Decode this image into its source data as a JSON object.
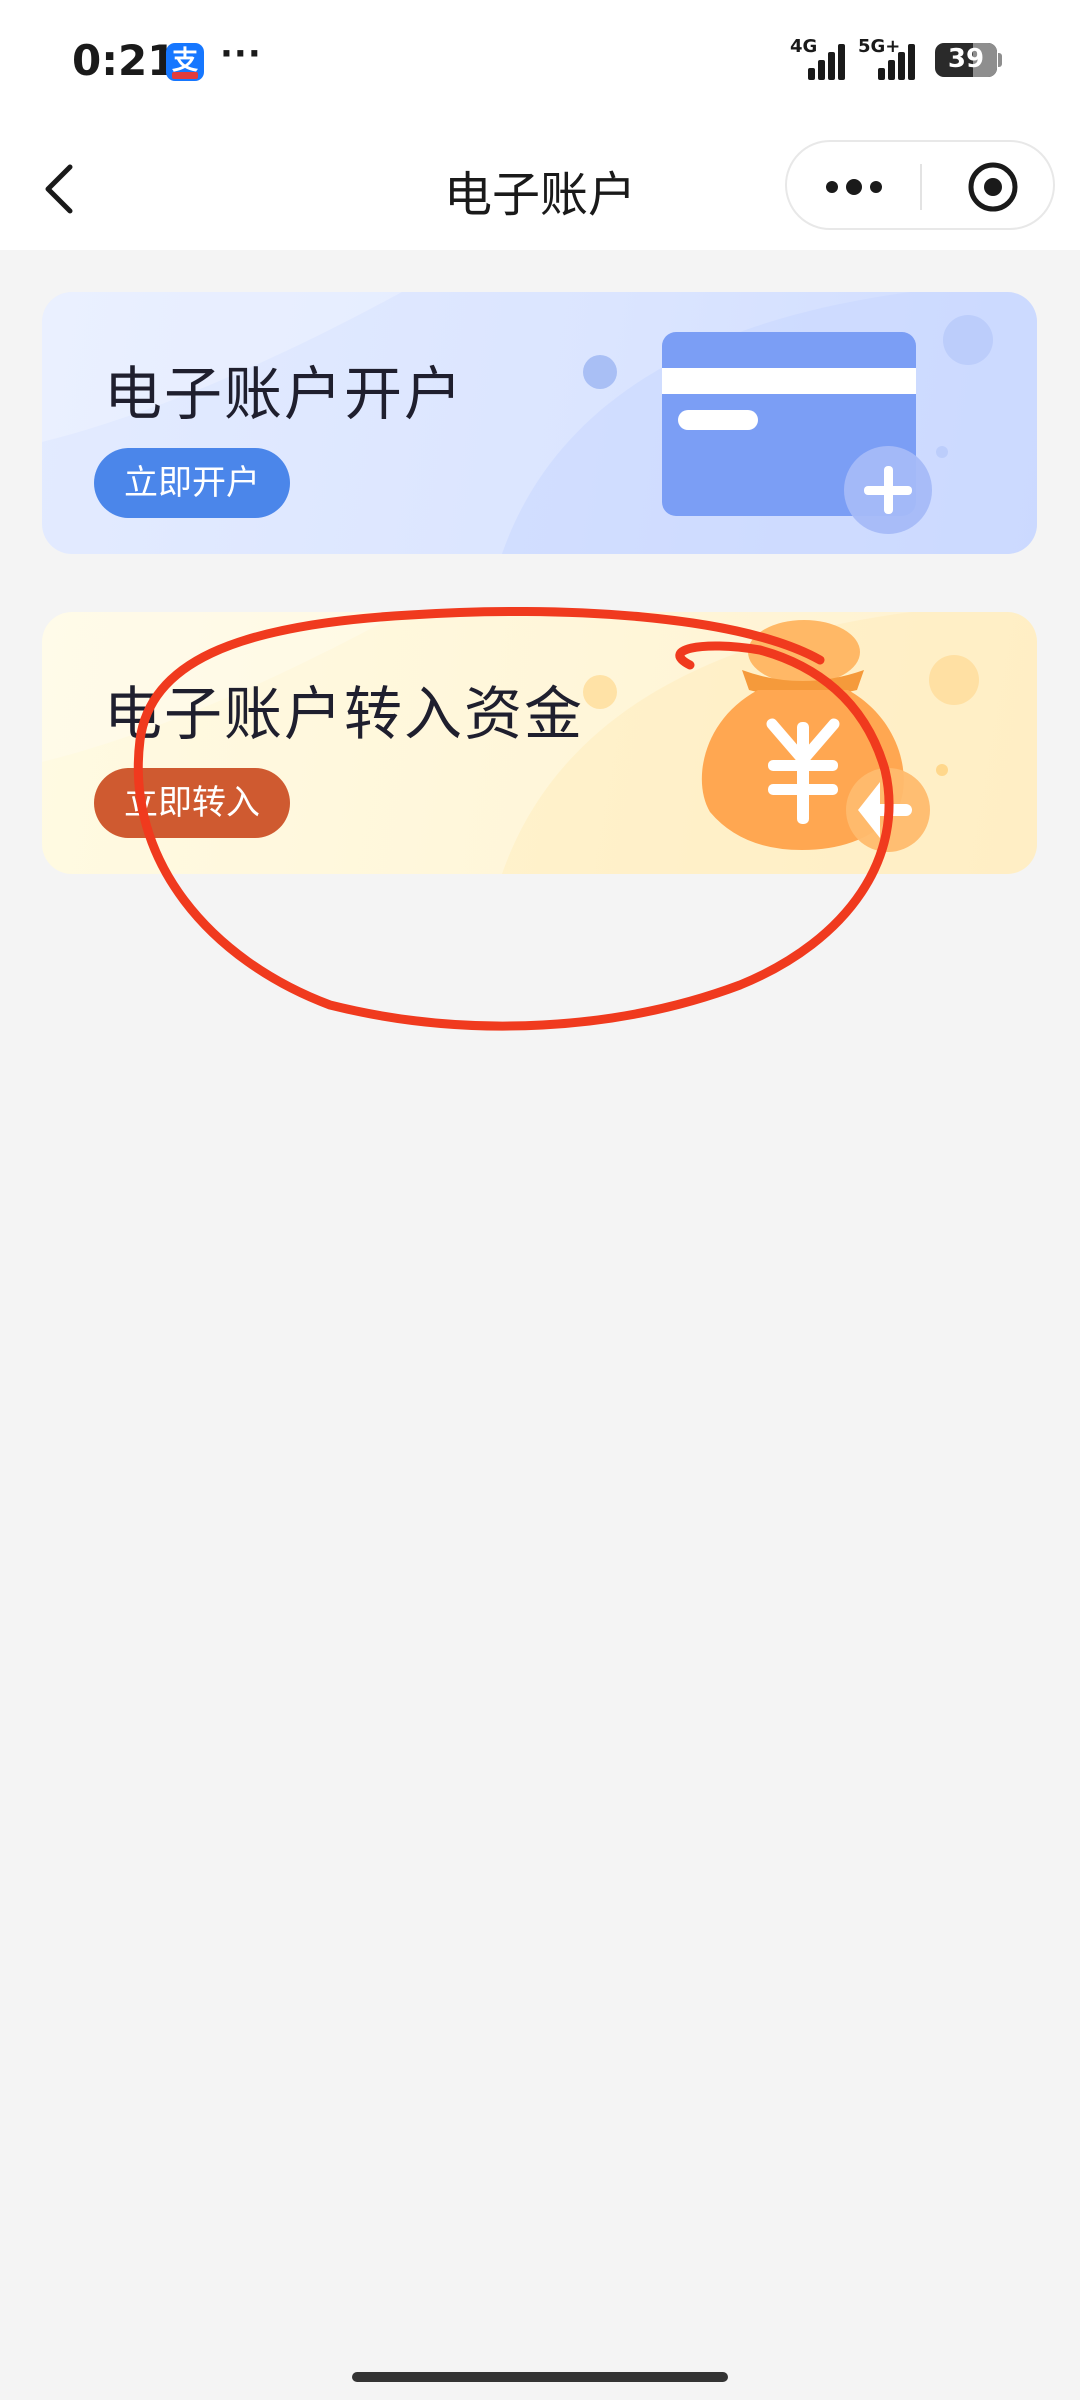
{
  "status_bar": {
    "time": "0:21",
    "app_icon": "alipay-icon",
    "app_icon_glyph": "支",
    "more": "···",
    "network_1": "4G",
    "network_2": "5G+",
    "battery": "39"
  },
  "nav": {
    "title": "电子账户",
    "back_icon": "chevron-left-icon",
    "more_icon": "more-dots-icon",
    "close_icon": "target-close-icon"
  },
  "cards": [
    {
      "title": "电子账户开户",
      "button": "立即开户",
      "illustration": "bank-card-plus-icon"
    },
    {
      "title": "电子账户转入资金",
      "button": "立即转入",
      "illustration": "money-bag-yuan-icon"
    }
  ],
  "colors": {
    "primary_blue": "#4b86ea",
    "primary_orange": "#cf5a30",
    "annotation_red": "#f03a1e",
    "page_bg": "#f4f4f4"
  }
}
